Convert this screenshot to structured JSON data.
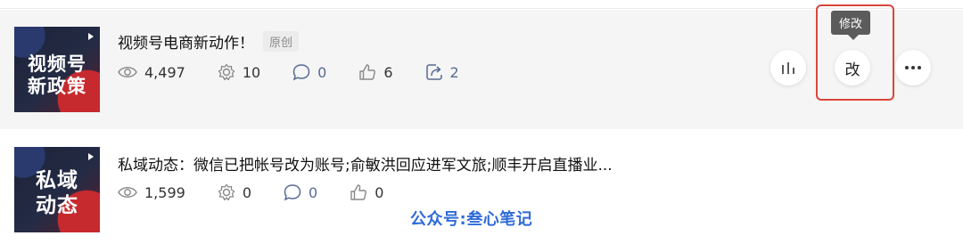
{
  "articles": [
    {
      "thumb_text": "视频号\n新政策",
      "title": "视频号电商新动作！",
      "badge": "原创",
      "views": "4,497",
      "shares": "10",
      "comments": "0",
      "likes": "6",
      "forwards": "2"
    },
    {
      "thumb_text": "私域\n动态",
      "title": "私域动态：微信已把帐号改为账号;俞敏洪回应进军文旅;顺丰开启直播业...",
      "views": "1,599",
      "shares": "0",
      "comments": "0",
      "likes": "0"
    }
  ],
  "actions": {
    "edit_label": "改",
    "tooltip": "修改"
  },
  "watermark": "公众号:叁心笔记",
  "colors": {
    "accent_blue": "#576b95",
    "highlight_red": "#d9463b",
    "watermark_blue": "#2f6bd8"
  }
}
